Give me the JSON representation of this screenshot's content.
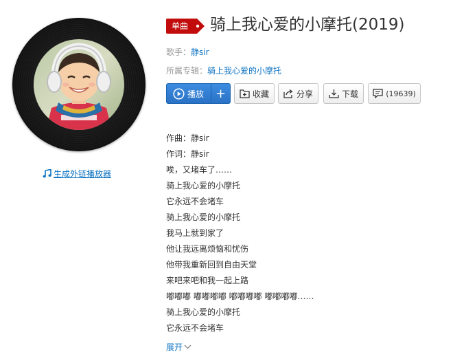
{
  "song": {
    "badge": "单曲",
    "title": "骑上我心爱的小摩托(2019)",
    "singer_label": "歌手：",
    "singer": "静sir",
    "album_label": "所属专辑：",
    "album": "骑上我心爱的小摩托"
  },
  "cover": {
    "player_link": "生成外链播放器"
  },
  "actions": {
    "play": "播放",
    "add": "+",
    "favorite": "收藏",
    "share": "分享",
    "download": "下载",
    "comments": "(19639)"
  },
  "lyrics": [
    "作曲：静sir",
    "作词：静sir",
    "唉，又堵车了……",
    "骑上我心爱的小摩托",
    "它永远不会堵车",
    "骑上我心爱的小摩托",
    "我马上就到家了",
    "他让我远离烦恼和忧伤",
    "他带我重新回到自由天堂",
    "来吧来吧和我一起上路",
    "嘟嘟嘟 嘟嘟嘟嘟 嘟嘟嘟嘟 嘟嘟嘟嘟……",
    "骑上我心爱的小摩托",
    "它永远不会堵车"
  ],
  "expand_label": "展开",
  "colors": {
    "link": "#0c73c2",
    "badge_red": "#c20c0c",
    "play_blue": "#2a72c5"
  },
  "icons": {
    "play": "play-circle-icon",
    "favorite": "folder-add-icon",
    "share": "share-icon",
    "download": "download-icon",
    "comments": "comment-icon",
    "player_link": "music-note-icon",
    "expand": "chevron-down-icon"
  }
}
